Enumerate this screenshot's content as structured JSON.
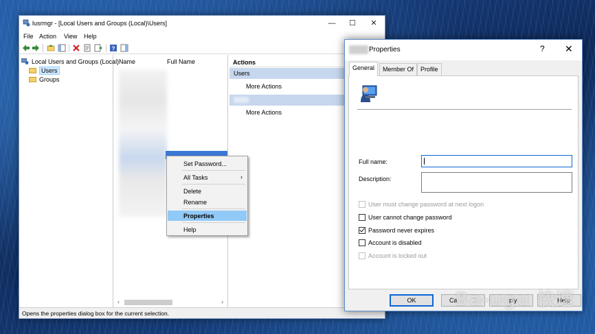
{
  "main_window": {
    "title": "lusrmgr - [Local Users and Groups (Local)\\Users]",
    "controls": {
      "minimize": "—",
      "maximize": "☐",
      "close": "✕"
    },
    "menu": [
      "File",
      "Action",
      "View",
      "Help"
    ],
    "tree": {
      "root": "Local Users and Groups (Local)",
      "children": [
        "Users",
        "Groups"
      ],
      "selected": "Users"
    },
    "list_columns": [
      "Name",
      "Full Name"
    ],
    "actions": {
      "header": "Actions",
      "section1": "Users",
      "section1_item": "More Actions",
      "section2_item": "More Actions"
    },
    "status": "Opens the properties dialog box for the current selection."
  },
  "context_menu": {
    "items": [
      "Set Password...",
      "All Tasks",
      "Delete",
      "Rename",
      "Properties",
      "Help"
    ],
    "highlighted": "Properties",
    "submenu_arrow": "›"
  },
  "dialog": {
    "title": "Properties",
    "help": "?",
    "close": "✕",
    "tabs": [
      "General",
      "Member Of",
      "Profile"
    ],
    "active_tab": "General",
    "fields": {
      "full_name_label": "Full name:",
      "full_name_value": "",
      "description_label": "Description:",
      "description_value": ""
    },
    "checkboxes": [
      {
        "label": "User must change password at next logon",
        "checked": false,
        "enabled": false
      },
      {
        "label": "User cannot change password",
        "checked": false,
        "enabled": true
      },
      {
        "label": "Password never expires",
        "checked": true,
        "enabled": true
      },
      {
        "label": "Account is disabled",
        "checked": false,
        "enabled": true
      },
      {
        "label": "Account is locked out",
        "checked": false,
        "enabled": false
      }
    ],
    "buttons": [
      "OK",
      "Ca",
      "ply",
      "Help"
    ]
  },
  "watermark": "Ba-ugu 快速",
  "colors": {
    "selection": "#3a78d6",
    "menu_highlight": "#91c9f7",
    "focus_border": "#0a64d6",
    "action_section": "#c6d7ee"
  }
}
